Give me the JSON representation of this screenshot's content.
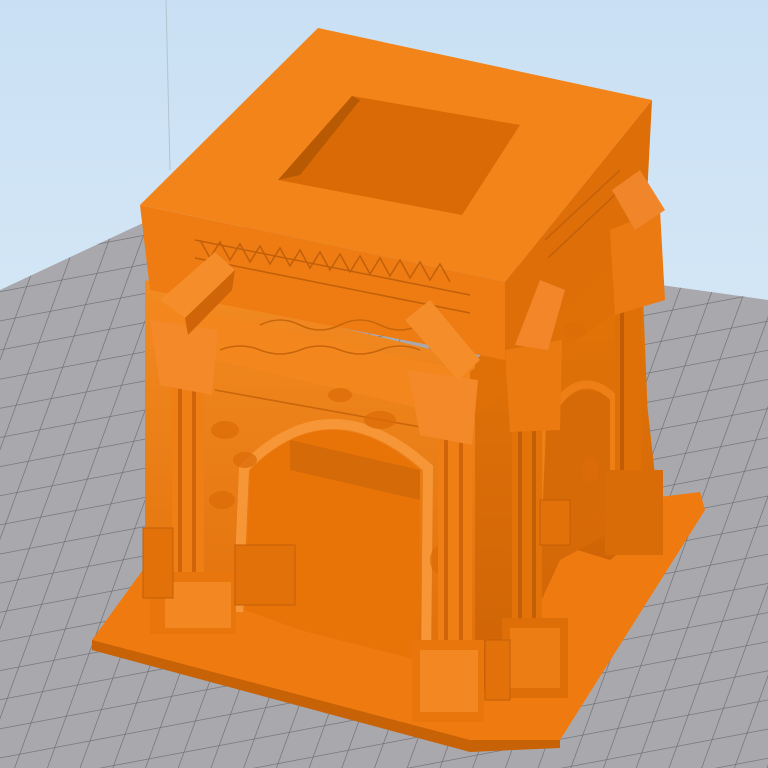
{
  "viewport": {
    "kind": "3d-model-preview",
    "background_top": "#c9e0f4",
    "background_bottom": "#dfeef9"
  },
  "build_plate": {
    "fill": "#a9a9ad",
    "grid_color": "#6e6e74"
  },
  "model": {
    "subject": "roman-triumphal-arch",
    "color": "#f07d12",
    "shadow_color": "#c05f08",
    "highlight_color": "#ff9a3a"
  }
}
